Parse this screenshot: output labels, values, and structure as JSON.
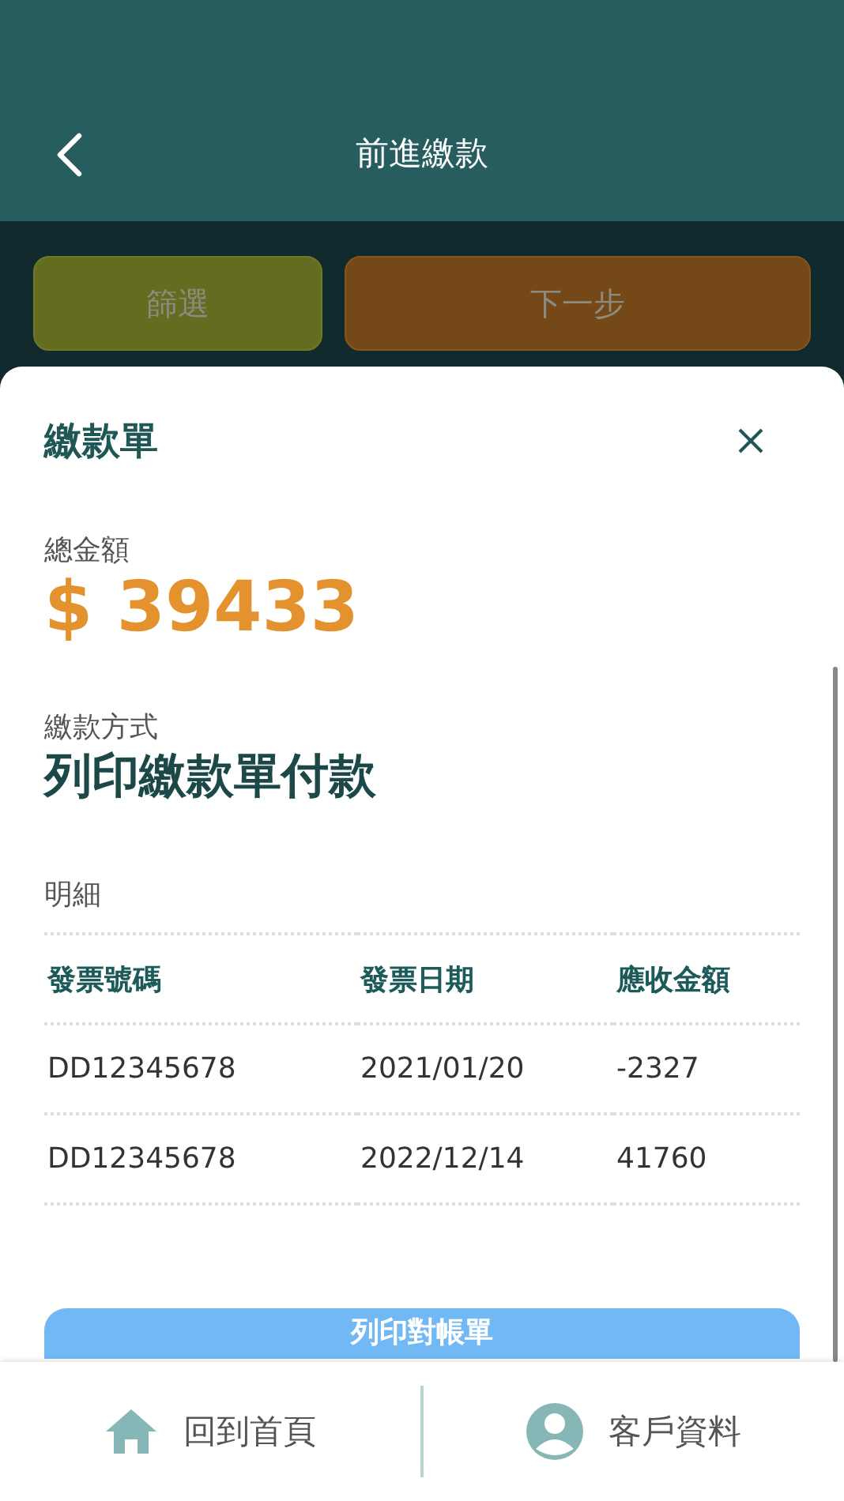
{
  "header": {
    "title": "前進繳款"
  },
  "actions": [
    {
      "label": "篩選",
      "kind": "filter"
    },
    {
      "label": "下一步",
      "kind": "next"
    }
  ],
  "sheet": {
    "title": "繳款單",
    "total_label": "總金額",
    "total_amount": "$ 39433",
    "method_label": "繳款方式",
    "method": "列印繳款單付款",
    "details_label": "明細",
    "table": {
      "columns": [
        "發票號碼",
        "發票日期",
        "應收金額"
      ],
      "rows": [
        [
          "DD12345678",
          "2021/01/20",
          "-2327"
        ],
        [
          "DD12345678",
          "2022/12/14",
          "41760"
        ]
      ]
    },
    "print_button": "列印對帳單"
  },
  "bottom_nav": [
    {
      "label": "回到首頁",
      "kind": "home"
    },
    {
      "label": "客戶資料",
      "kind": "profile"
    }
  ]
}
